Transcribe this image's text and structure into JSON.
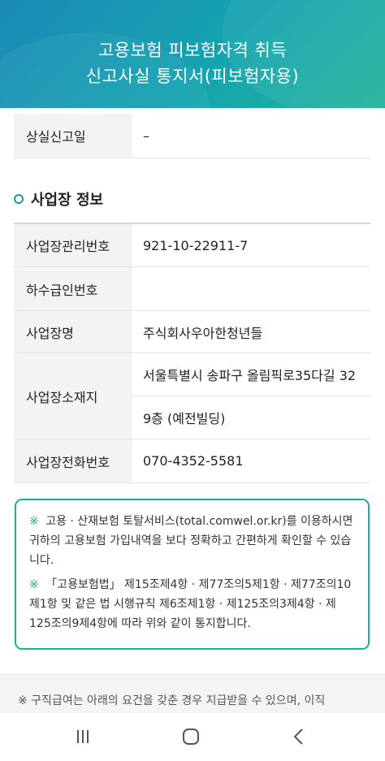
{
  "header": {
    "title_line1": "고용보험 피보험자격 취득",
    "title_line2": "신고사실 통지서(피보험자용)"
  },
  "loss_report": {
    "label": "상실신고일",
    "value": "–"
  },
  "workplace_section": {
    "title": "사업장 정보",
    "rows": [
      {
        "label": "사업장관리번호",
        "value": "921-10-22911-7"
      },
      {
        "label": "하수급인번호",
        "value": ""
      },
      {
        "label": "사업장명",
        "value": "주식회사우아한청년들"
      },
      {
        "label": "사업장소재지",
        "value_line1": "서울특별시 송파구 올림픽로35다길 32",
        "value_line2": "9층 (예전빌딩)"
      },
      {
        "label": "사업장전화번호",
        "value": "070-4352-5581"
      }
    ]
  },
  "notice": {
    "mark": "※",
    "para1": "고용 · 산재보험 토탈서비스(total.comwel.or.kr)를 이용하시면 귀하의 고용보험 가입내역을 보다 정확하고 간편하게 확인할 수 있습니다.",
    "para2": "「고용보험법」 제15조제4항 · 제77조의5제1항 · 제77조의10제1항 및 같은 법 시행규칙 제6조제1항 · 제125조의3제4항 · 제125조의9제4항에 따라 위와 같이 통지합니다."
  },
  "bottom_notice": {
    "text": "※ 구직급여는 아래의 요건을 갖춘 경우 지급받을 수 있으며, 이직"
  },
  "colors": {
    "accent": "#1fae94",
    "header_start": "#1c8ab8",
    "header_end": "#20b59a"
  },
  "nav": {
    "recent_icon": "recent-apps-icon",
    "home_icon": "home-icon",
    "back_icon": "back-icon"
  }
}
